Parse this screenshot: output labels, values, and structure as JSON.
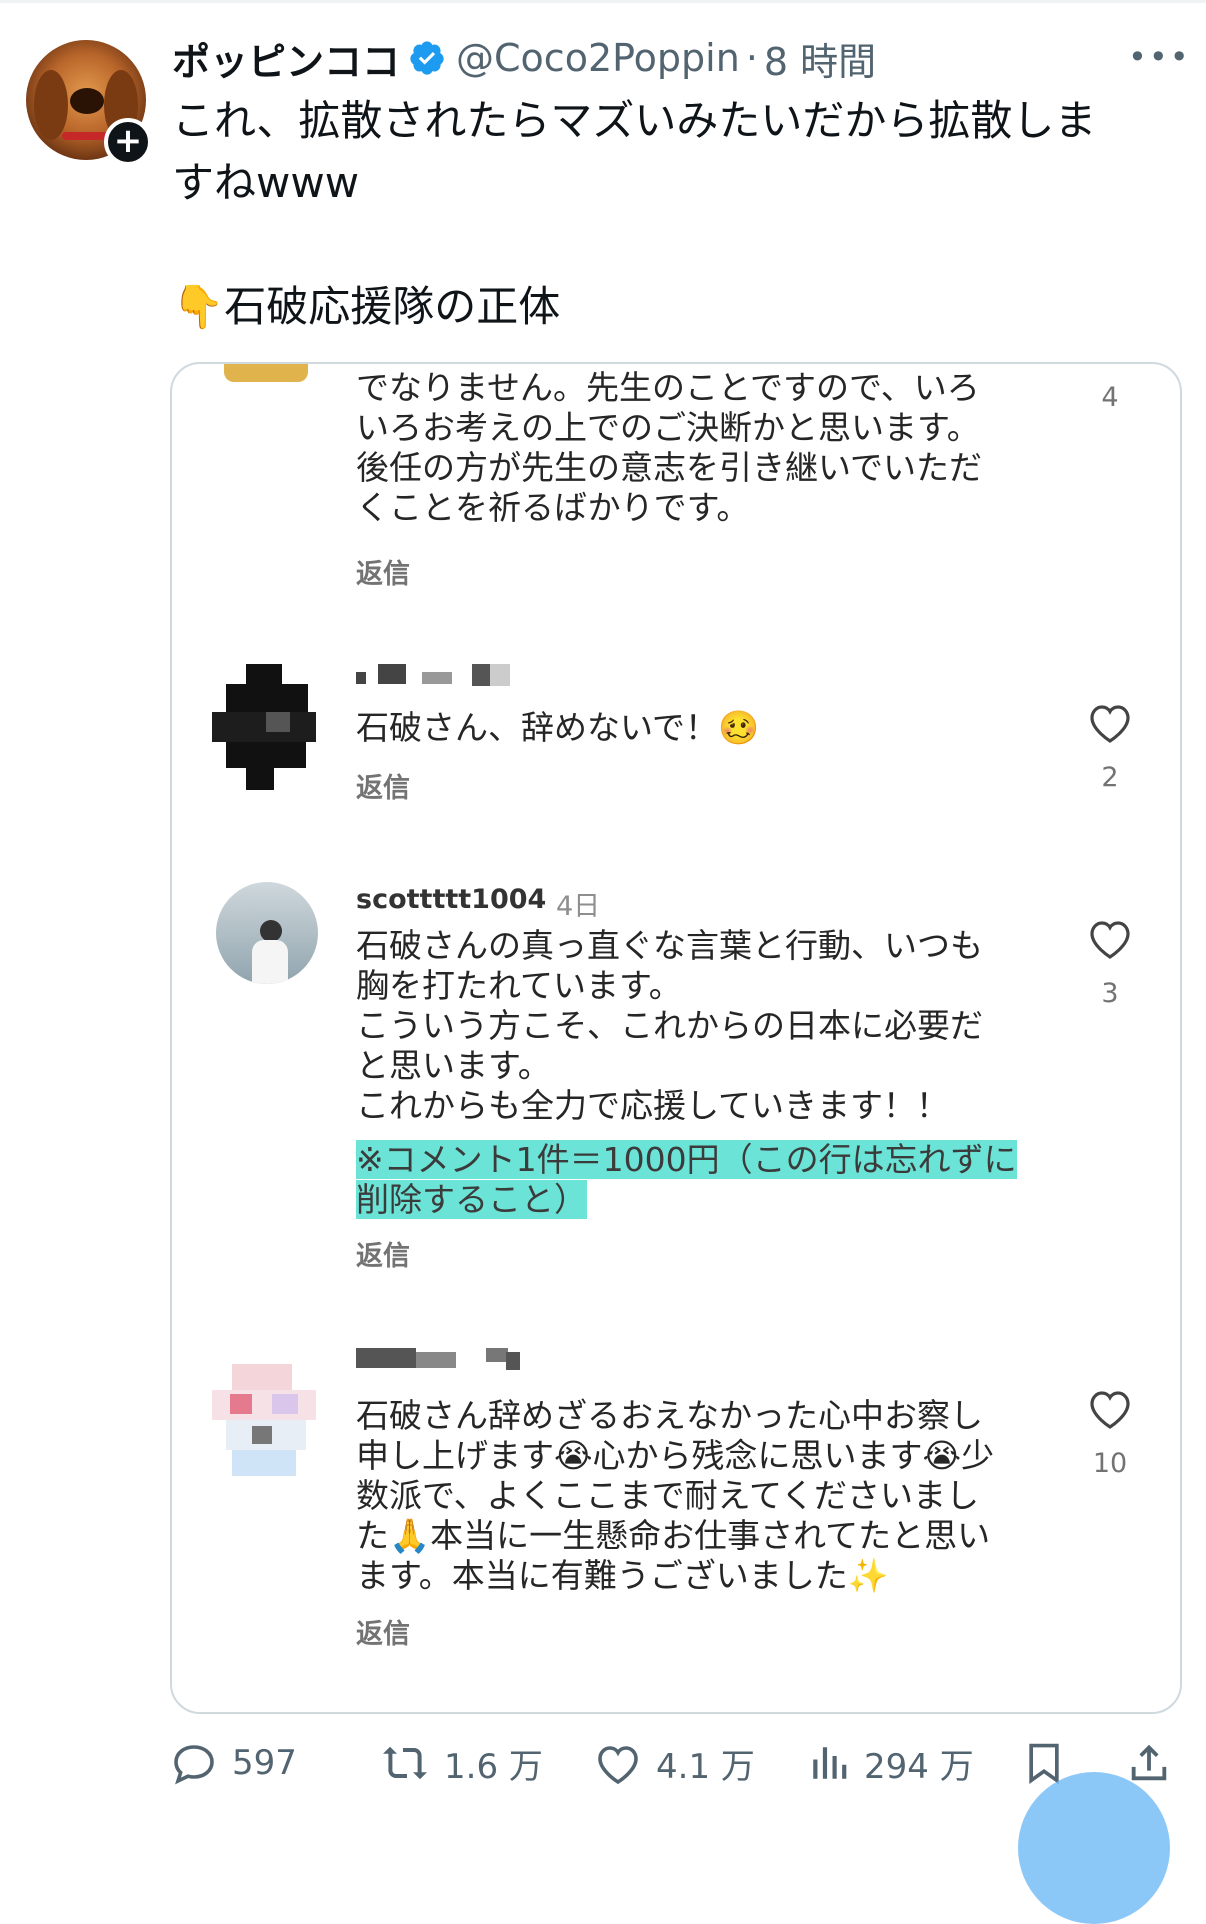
{
  "post": {
    "display_name": "ポッピンココ",
    "handle": "@Coco2Poppin",
    "separator": "·",
    "time": "8 時間",
    "more": "•••",
    "text_lines": [
      "これ、拡散されたらマズいみたいだから拡散しま",
      "すねwww",
      "👇石破応援隊の正体"
    ]
  },
  "media": {
    "comments": [
      {
        "text_lines": [
          "でなりません。先生のことですので、いろ",
          "いろお考えの上でのご決断かと思います。",
          "後任の方が先生の意志を引き継いでいただ",
          "くことを祈るばかりです。"
        ],
        "reply": "返信",
        "likes": "4"
      },
      {
        "text_lines": [
          "石破さん、辞めないで！🥴"
        ],
        "reply": "返信",
        "likes": "2"
      },
      {
        "username": "scottttt1004",
        "date": "4日",
        "text_lines": [
          "石破さんの真っ直ぐな言葉と行動、いつも",
          "胸を打たれています。",
          "こういう方こそ、これからの日本に必要だ",
          "と思います。",
          "これからも全力で応援していきます！！"
        ],
        "highlight_lines": [
          "※コメント1件＝1000円（この行は忘れずに",
          "削除すること）"
        ],
        "reply": "返信",
        "likes": "3"
      },
      {
        "text_lines": [
          "石破さん辞めざるおえなかった心中お察し",
          "申し上げます😭心から残念に思います😭少",
          "数派で、よくここまで耐えてくださいまし",
          "た🙏本当に一生懸命お仕事されてたと思い",
          "ます。本当に有難うございました✨"
        ],
        "reply": "返信",
        "likes": "10"
      }
    ]
  },
  "actions": {
    "replies": "597",
    "reposts": "1.6 万",
    "likes": "4.1 万",
    "views": "294 万"
  },
  "colors": {
    "accent": "#1d9bf0",
    "highlight": "#5ce0d2",
    "muted": "#536471"
  }
}
